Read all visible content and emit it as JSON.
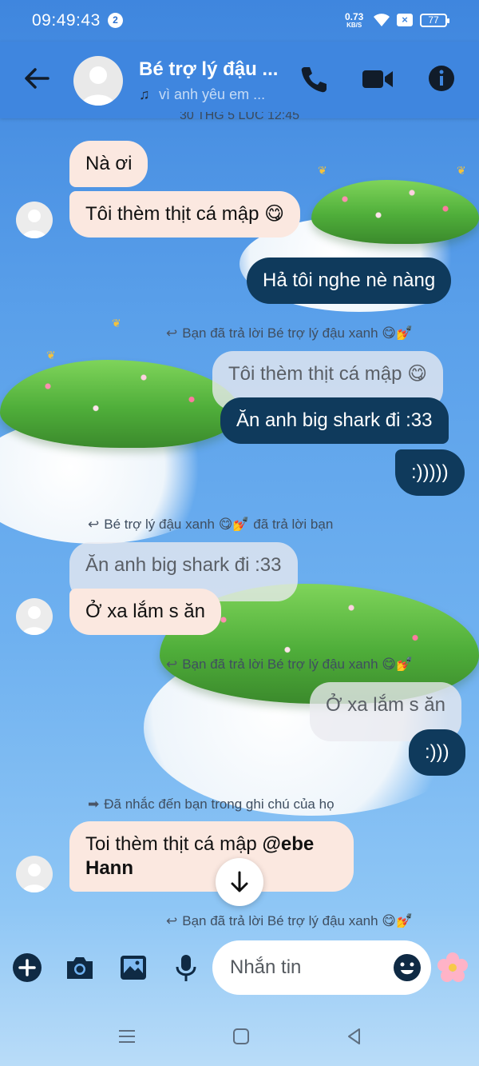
{
  "status_bar": {
    "time": "09:49:43",
    "notification_count": "2",
    "net_speed_value": "0.73",
    "net_speed_unit": "KB/S",
    "battery": "77"
  },
  "header": {
    "contact_name": "Bé trợ lý đậu ...",
    "contact_status": "vì anh yêu em ..."
  },
  "date_divider": "30 THG 5 LÚC 12:45",
  "messages": [
    {
      "text": "Nà ơi"
    },
    {
      "text": "Tôi thèm thịt cá mập 😋"
    },
    {
      "text": "Hả tôi nghe nè nàng"
    },
    {
      "reply_note": "Bạn đã trả lời Bé trợ lý đậu xanh 😋💅",
      "quote": "Tôi thèm thịt cá mập 😋",
      "text": "Ăn anh big shark đi :33"
    },
    {
      "text": ":)))))"
    },
    {
      "reply_note": "Bé trợ lý đậu xanh 😋💅 đã trả lời bạn",
      "quote": "Ăn anh big shark đi :33",
      "text": "Ở xa lắm s ăn"
    },
    {
      "reply_note": "Bạn đã trả lời Bé trợ lý đậu xanh 😋💅",
      "quote": "Ở xa lắm s ăn",
      "text": ":)))"
    },
    {
      "reply_note": "Đã nhắc đến bạn trong ghi chú của họ",
      "text": "Toi thèm thịt cá mập ",
      "mention_line1": "@ebe",
      "mention_line2": "Hann"
    },
    {
      "reply_note": "Bạn đã trả lời Bé trợ lý đậu xanh 😋💅"
    }
  ],
  "composer": {
    "placeholder": "Nhắn tin"
  },
  "colors": {
    "header": "#3f86de",
    "incoming_bubble": "#fbe8e0",
    "outgoing_bubble": "#0f3a5c"
  },
  "icons": [
    "back-arrow-icon",
    "phone-icon",
    "video-camera-icon",
    "info-icon",
    "music-note-icon",
    "reply-arrow-icon",
    "mention-arrow-icon",
    "arrow-down-icon",
    "plus-icon",
    "camera-icon",
    "image-icon",
    "microphone-icon",
    "emoji-icon",
    "flower-icon",
    "menu-icon",
    "home-icon",
    "nav-back-icon"
  ]
}
